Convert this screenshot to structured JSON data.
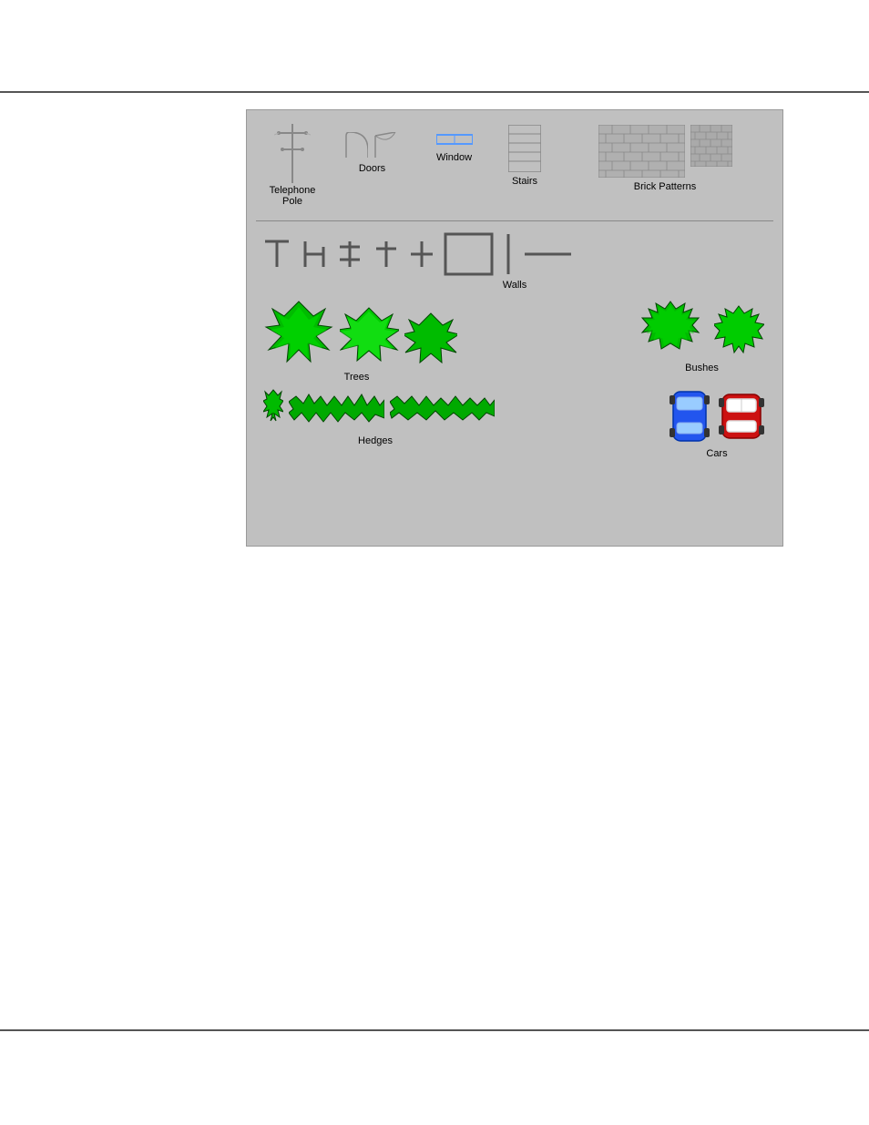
{
  "panel": {
    "background": "#c0c0c0"
  },
  "labels": {
    "telephone_pole": "Telephone\nPole",
    "doors": "Doors",
    "window": "Window",
    "stairs": "Stairs",
    "brick_patterns": "Brick Patterns",
    "walls": "Walls",
    "trees": "Trees",
    "bushes": "Bushes",
    "hedges": "Hedges",
    "cars": "Cars"
  },
  "top_rule": true,
  "bottom_rule": true
}
